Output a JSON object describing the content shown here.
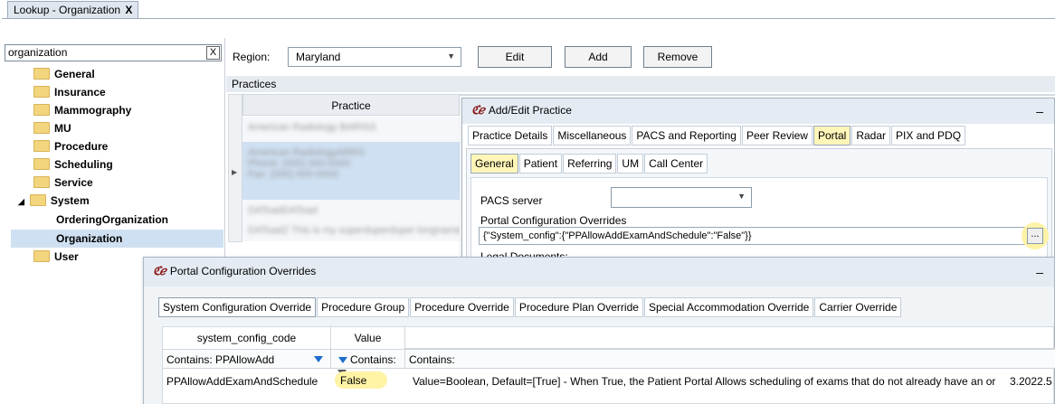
{
  "outer_tab": {
    "title": "Lookup - Organization",
    "close": "X"
  },
  "tree": {
    "search_value": "organization",
    "clear": "X",
    "items": [
      {
        "label": "General"
      },
      {
        "label": "Insurance"
      },
      {
        "label": "Mammography"
      },
      {
        "label": "MU"
      },
      {
        "label": "Procedure"
      },
      {
        "label": "Scheduling"
      },
      {
        "label": "Service"
      },
      {
        "label": "System"
      },
      {
        "label": "OrderingOrganization"
      },
      {
        "label": "Organization"
      },
      {
        "label": "User"
      }
    ],
    "expand_glyph": "◢"
  },
  "region": {
    "label": "Region:",
    "value": "Maryland"
  },
  "buttons": {
    "edit": "Edit",
    "add": "Add",
    "remove": "Remove"
  },
  "practices": {
    "section_label": "Practices",
    "column": "Practice",
    "rows": [
      "American Radiology BARISS",
      "American RadiologyARRS\nPhone: (000) 000-0000\nFax: (000) 000-0000",
      "DAToadDAToad",
      "DAToadZ This is my superduperduper longname"
    ]
  },
  "add_edit": {
    "title": "Add/Edit Practice",
    "logo": "ℭℯ",
    "minimize": "–",
    "tabs": [
      "Practice Details",
      "Miscellaneous",
      "PACS and Reporting",
      "Peer Review",
      "Portal",
      "Radar",
      "PIX and PDQ"
    ],
    "active_tab": "Portal",
    "subtabs": [
      "General",
      "Patient",
      "Referring",
      "UM",
      "Call Center"
    ],
    "active_subtab": "General",
    "pacs_label": "PACS server",
    "pacs_value": "",
    "overrides_label": "Portal Configuration Overrides",
    "overrides_value": "{\"System_config\":{\"PPAllowAddExamAndSchedule\":\"False\"}}",
    "ellipsis": "...",
    "legal_label": "Legal Documents:"
  },
  "portal_overrides": {
    "title": "Portal Configuration Overrides",
    "minimize": "–",
    "tabs": [
      "System Configuration Override",
      "Procedure Group",
      "Procedure Override",
      "Procedure Plan Override",
      "Special Accommodation Override",
      "Carrier Override"
    ],
    "active_tab": "System Configuration Override",
    "columns": [
      "system_config_code",
      "Value"
    ],
    "filters": [
      "Contains: PPAllowAdd",
      "Contains:",
      "Contains:"
    ],
    "row": {
      "code": "PPAllowAddExamAndSchedule",
      "value": "False",
      "description": "Value=Boolean, Default=[True] - When True, the Patient Portal Allows scheduling of exams that do not already have an or",
      "version": "3.2022.5"
    }
  },
  "colors": {
    "highlight": "#fff3a6",
    "selection": "#cfe0f2",
    "brand": "#8b1d1d"
  }
}
